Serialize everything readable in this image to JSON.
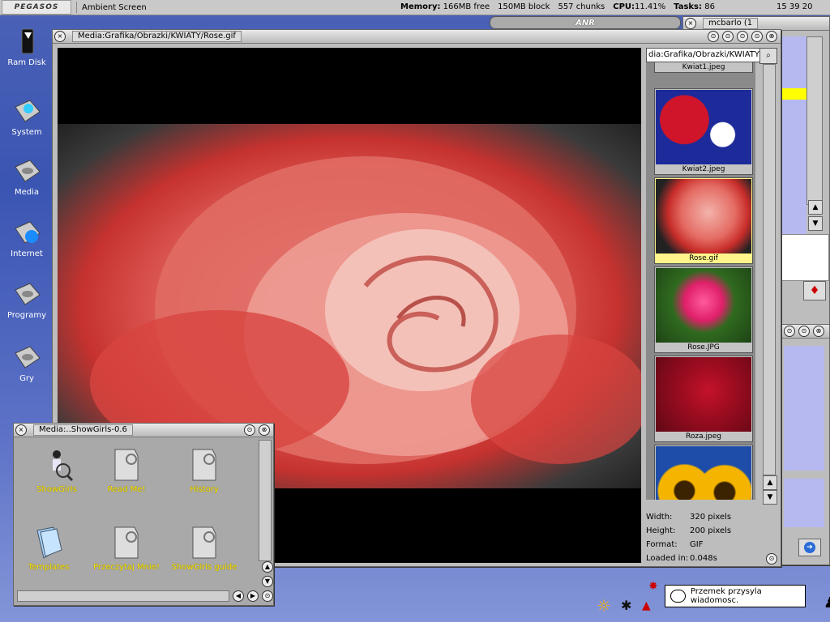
{
  "screenbar": {
    "logo": "PEGASOS",
    "title": "Ambient Screen",
    "memory_label": "Memory:",
    "memory_free": "166MB free",
    "memory_block": "150MB block",
    "chunks": "557 chunks",
    "cpu_label": "CPU:",
    "cpu_value": "11.41%",
    "tasks_label": "Tasks:",
    "tasks_value": "86",
    "clock": "15 39 20"
  },
  "desktop_icons": [
    {
      "label": "Ram Disk"
    },
    {
      "label": "System"
    },
    {
      "label": "Media"
    },
    {
      "label": "Internet"
    },
    {
      "label": "Programy"
    },
    {
      "label": "Gry"
    }
  ],
  "viewer": {
    "title": "Media:Grafika/Obrazki/KWIATY/Rose.gif",
    "path": "dia:Grafika/Obrazki/KWIATY",
    "thumbnails": [
      {
        "caption": "Kwiat1.jpeg"
      },
      {
        "caption": "Kwiat2.jpeg"
      },
      {
        "caption": "Rose.gif"
      },
      {
        "caption": "Rose.JPG"
      },
      {
        "caption": "Roza.jpeg"
      },
      {
        "caption": ""
      }
    ],
    "info": {
      "width_label": "Width:",
      "width_value": "320 pixels",
      "height_label": "Height:",
      "height_value": "200 pixels",
      "format_label": "Format:",
      "format_value": "GIF",
      "loaded_label": "Loaded in:",
      "loaded_value": "0.048s"
    }
  },
  "drawer": {
    "title": "Media:..ShowGirls-0.6",
    "items": [
      {
        "label": "ShowGirls"
      },
      {
        "label": "Read Me!"
      },
      {
        "label": "History"
      },
      {
        "label": "Templates"
      },
      {
        "label": "Przeczytaj Mnie!"
      },
      {
        "label": "ShowGirls guide"
      }
    ]
  },
  "right_window": {
    "title": "mcbarlo (1"
  },
  "amp_bar": {
    "label": "ANR"
  },
  "tooltip": {
    "text": "Przemek przysyla wiadomosc."
  },
  "colors": {
    "desktop_blue": "#3a55b2",
    "selection_yellow": "#fff58a",
    "label_yellow": "#ffe600"
  }
}
